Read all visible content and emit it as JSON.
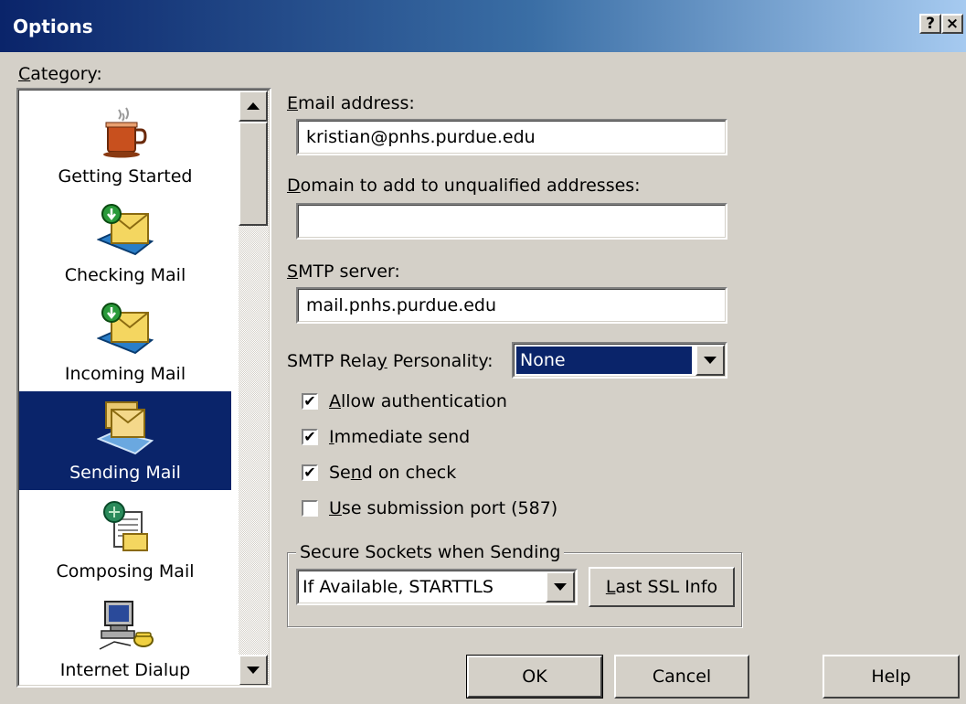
{
  "window": {
    "title": "Options",
    "help_button": "?",
    "close_button": "×"
  },
  "category": {
    "label": "Category:",
    "items": [
      {
        "label": "Getting Started",
        "icon": "coffee-cup-icon",
        "selected": false
      },
      {
        "label": "Checking Mail",
        "icon": "mail-download-icon",
        "selected": false
      },
      {
        "label": "Incoming Mail",
        "icon": "mail-download-icon",
        "selected": false
      },
      {
        "label": "Sending Mail",
        "icon": "mail-send-icon",
        "selected": true
      },
      {
        "label": "Composing Mail",
        "icon": "compose-mail-icon",
        "selected": false
      },
      {
        "label": "Internet Dialup",
        "icon": "computer-phone-icon",
        "selected": false
      }
    ]
  },
  "form": {
    "email_label": "Email address:",
    "email_value": "kristian@pnhs.purdue.edu",
    "domain_label": "Domain to add to unqualified addresses:",
    "domain_value": "",
    "smtp_label": "SMTP server:",
    "smtp_value": "mail.pnhs.purdue.edu",
    "relay_label": "SMTP Relay Personality:",
    "relay_value": "None",
    "checkboxes": [
      {
        "label": "Allow authentication",
        "checked": true
      },
      {
        "label": "Immediate send",
        "checked": true
      },
      {
        "label": "Send on check",
        "checked": true
      },
      {
        "label": "Use submission port (587)",
        "checked": false
      }
    ],
    "ssl_group_label": "Secure Sockets when Sending",
    "ssl_value": "If Available, STARTTLS",
    "last_ssl_button": "Last SSL Info"
  },
  "buttons": {
    "ok": "OK",
    "cancel": "Cancel",
    "help": "Help"
  }
}
